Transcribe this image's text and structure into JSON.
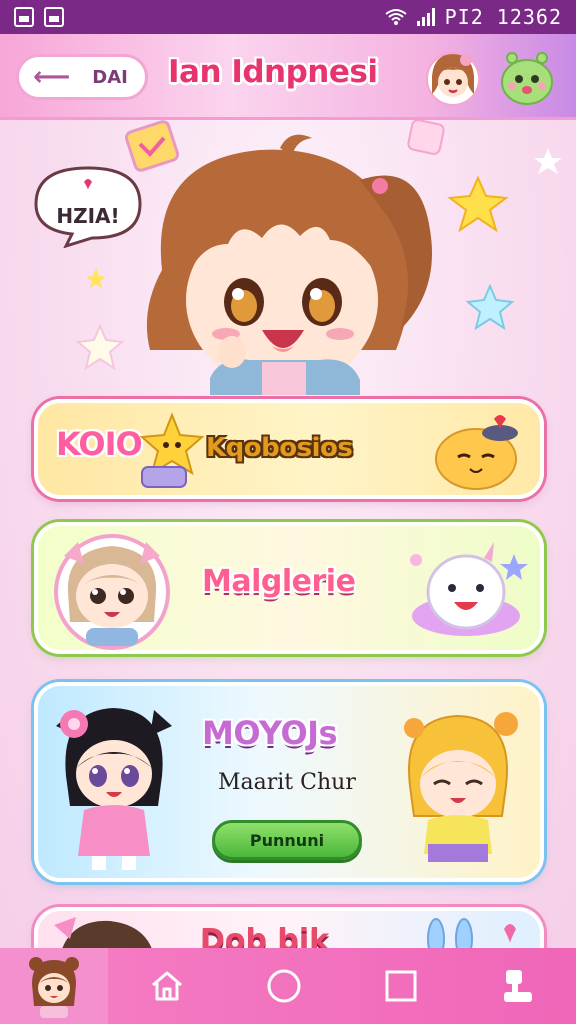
{
  "status_bar": {
    "time": "PI2 12362"
  },
  "header": {
    "back_label": "DAI",
    "title": "Ian Idnpnesi"
  },
  "hero": {
    "speech_text": "HZIA!"
  },
  "cards": [
    {
      "tag": "KOIO",
      "title": "Kqobosios"
    },
    {
      "title": "Malglerie"
    },
    {
      "title": "MOYOJs",
      "subtitle": "Maarit Chur",
      "button_label": "Punnuni"
    },
    {
      "title": "Dob bik"
    }
  ],
  "tabbar": {
    "items": [
      "avatar",
      "home-icon",
      "circle-icon",
      "square-icon",
      "puzzle-icon"
    ]
  },
  "colors": {
    "status_bar": "#7a2a86",
    "tabbar": "#f066b8",
    "title_pink": "#e8346e"
  }
}
